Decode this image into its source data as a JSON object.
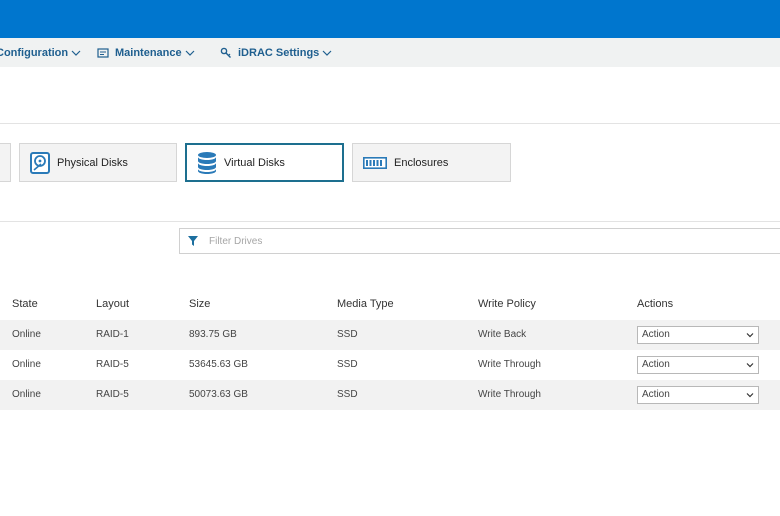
{
  "nav": {
    "configuration": "Configuration",
    "maintenance": "Maintenance",
    "idrac_settings": "iDRAC Settings"
  },
  "tabs": {
    "physical_disks": "Physical Disks",
    "virtual_disks": "Virtual Disks",
    "enclosures": "Enclosures",
    "active": "virtual_disks"
  },
  "filter": {
    "placeholder": "Filter Drives"
  },
  "table": {
    "headers": {
      "state": "State",
      "layout": "Layout",
      "size": "Size",
      "media_type": "Media Type",
      "write_policy": "Write Policy",
      "actions": "Actions"
    },
    "rows": [
      {
        "state": "Online",
        "layout": "RAID-1",
        "size": "893.75 GB",
        "media_type": "SSD",
        "write_policy": "Write Back",
        "action": "Action"
      },
      {
        "state": "Online",
        "layout": "RAID-5",
        "size": "53645.63 GB",
        "media_type": "SSD",
        "write_policy": "Write Through",
        "action": "Action"
      },
      {
        "state": "Online",
        "layout": "RAID-5",
        "size": "50073.63 GB",
        "media_type": "SSD",
        "write_policy": "Write Through",
        "action": "Action"
      }
    ]
  },
  "colors": {
    "header": "#0076ce",
    "nav_text": "#1f5f8f",
    "active_tab_border": "#1d6f8f",
    "icon_accent": "#2a7ab8"
  },
  "icons": {
    "nav_configuration": "chevron-down-icon",
    "nav_maintenance": "maintenance-icon",
    "nav_idrac": "key-icon",
    "physical_disks": "hard-disk-icon",
    "virtual_disks": "database-icon",
    "enclosures": "enclosure-icon",
    "filter": "funnel-icon"
  }
}
